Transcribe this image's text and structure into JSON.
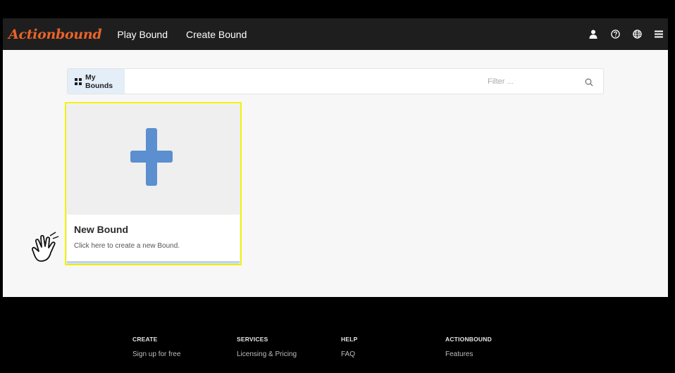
{
  "navbar": {
    "logo": "Actionbound",
    "links": [
      "Play Bound",
      "Create Bound"
    ],
    "icons": [
      "user-icon",
      "help-icon",
      "globe-icon",
      "menu-icon"
    ]
  },
  "toolbar": {
    "tab_label": "My Bounds",
    "filter_placeholder": "Filter ...",
    "filter_value": ""
  },
  "card": {
    "title": "New Bound",
    "description": "Click here to create a new Bound.",
    "icon": "plus-icon"
  },
  "footer": {
    "columns": [
      {
        "heading": "CREATE",
        "link": "Sign up for free"
      },
      {
        "heading": "SERVICES",
        "link": "Licensing & Pricing"
      },
      {
        "heading": "HELP",
        "link": "FAQ"
      },
      {
        "heading": "ACTIONBOUND",
        "link": "Features"
      }
    ]
  },
  "colors": {
    "brand": "#e8632a",
    "navbar_bg": "#1e1e1e",
    "accent_plus": "#5b8fcf",
    "highlight": "#f2f20c"
  }
}
